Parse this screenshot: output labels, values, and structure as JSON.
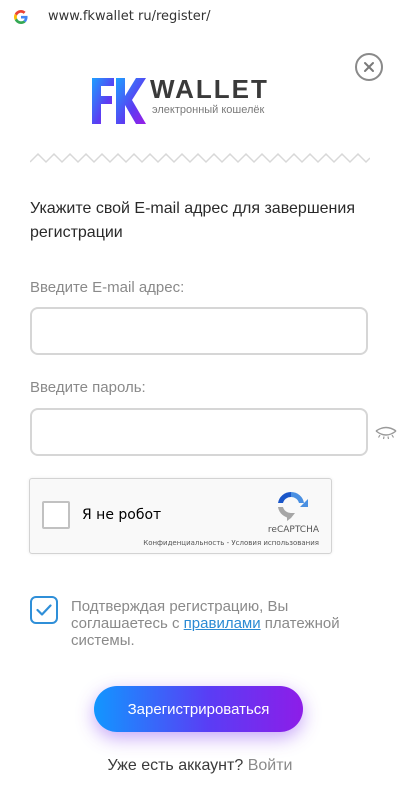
{
  "browser": {
    "url": "www.fkwallet ru/register/",
    "search_icon": "google-g-icon"
  },
  "logo": {
    "mark": "FK",
    "name": "WALLET",
    "tagline": "электронный кошелёк"
  },
  "close_icon": "close-icon",
  "intro_text": "Укажите свой E-mail адрес для завершения регистрации",
  "email": {
    "label": "Введите E-mail адрес:",
    "value": "",
    "placeholder": ""
  },
  "password": {
    "label": "Введите пароль:",
    "value": "",
    "placeholder": "",
    "toggle_icon": "eye-icon"
  },
  "captcha": {
    "label": "Я не робот",
    "brand": "reCAPTCHA",
    "terms": "Конфиденциальность - Условия использования",
    "checked": false
  },
  "agreement": {
    "checked": true,
    "text_before": "Подтверждая регистрацию, Вы соглашаетесь с ",
    "link": "правилами",
    "text_after": " платежной системы."
  },
  "register_button": "Зарегистрироваться",
  "login": {
    "prompt": "Уже есть аккаунт? ",
    "link": "Войти"
  },
  "colors": {
    "accent_blue": "#2a8ad3",
    "button_start": "#1296ff",
    "button_end": "#8d1de8"
  }
}
